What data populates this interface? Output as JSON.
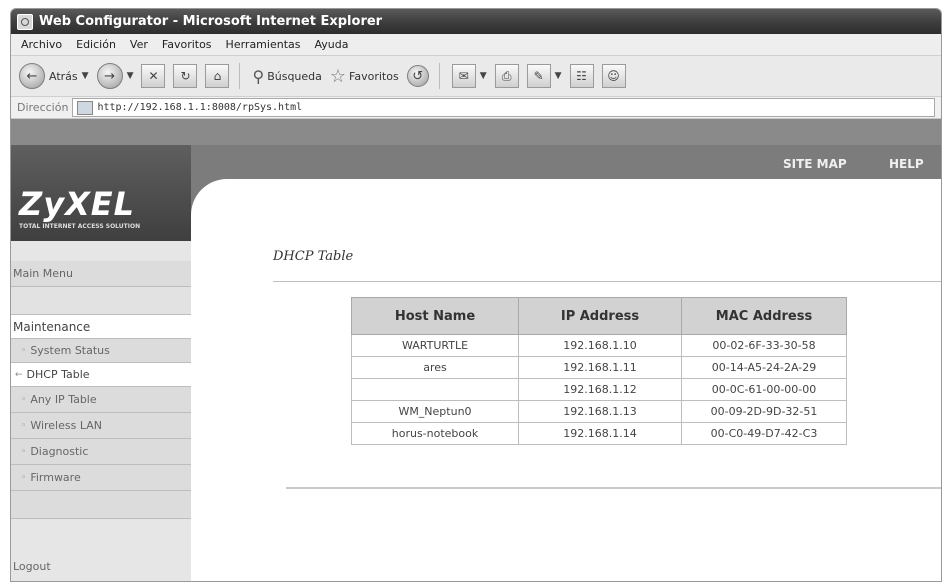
{
  "window": {
    "title": "Web Configurator - Microsoft Internet Explorer"
  },
  "menubar": [
    "Archivo",
    "Edición",
    "Ver",
    "Favoritos",
    "Herramientas",
    "Ayuda"
  ],
  "toolbar": {
    "back_label": "Atrás",
    "search_label": "Búsqueda",
    "favorites_label": "Favoritos"
  },
  "address": {
    "label": "Dirección",
    "url": "http://192.168.1.1:8008/rpSys.html"
  },
  "router": {
    "logo": "ZyXEL",
    "tagline": "TOTAL INTERNET ACCESS SOLUTION",
    "nav": {
      "site_map": "SITE MAP",
      "help": "HELP"
    }
  },
  "sidebar": {
    "main_menu": "Main Menu",
    "section": "Maintenance",
    "items": [
      {
        "label": "System Status"
      },
      {
        "label": "DHCP Table"
      },
      {
        "label": "Any IP Table"
      },
      {
        "label": "Wireless LAN"
      },
      {
        "label": "Diagnostic"
      },
      {
        "label": "Firmware"
      }
    ],
    "logout": "Logout"
  },
  "content": {
    "heading": "DHCP Table",
    "table": {
      "columns": [
        "Host Name",
        "IP Address",
        "MAC Address"
      ],
      "rows": [
        [
          "WARTURTLE",
          "192.168.1.10",
          "00-02-6F-33-30-58"
        ],
        [
          "ares",
          "192.168.1.11",
          "00-14-A5-24-2A-29"
        ],
        [
          "",
          "192.168.1.12",
          "00-0C-61-00-00-00"
        ],
        [
          "WM_Neptun0",
          "192.168.1.13",
          "00-09-2D-9D-32-51"
        ],
        [
          "horus-notebook",
          "192.168.1.14",
          "00-C0-49-D7-42-C3"
        ]
      ]
    }
  }
}
